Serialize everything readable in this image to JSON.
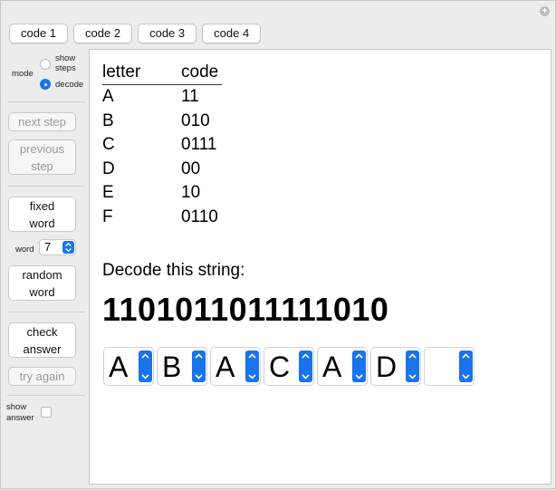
{
  "tabs": [
    "code 1",
    "code 2",
    "code 3",
    "code 4"
  ],
  "sidebar": {
    "mode_label": "mode",
    "options": [
      {
        "label_line1": "show",
        "label_line2": "steps",
        "selected": false
      },
      {
        "label_line1": "decode",
        "label_line2": "",
        "selected": true
      }
    ],
    "next_step": "next step",
    "previous_step_line1": "previous",
    "previous_step_line2": "step",
    "fixed_word_line1": "fixed",
    "fixed_word_line2": "word",
    "word_label": "word",
    "word_value": "7",
    "random_word_line1": "random",
    "random_word_line2": "word",
    "check_answer_line1": "check",
    "check_answer_line2": "answer",
    "try_again": "try again",
    "show_answer_line1": "show",
    "show_answer_line2": "answer",
    "show_answer_checked": false
  },
  "table": {
    "headers": [
      "letter",
      "code"
    ],
    "rows": [
      [
        "A",
        "11"
      ],
      [
        "B",
        "010"
      ],
      [
        "C",
        "0111"
      ],
      [
        "D",
        "00"
      ],
      [
        "E",
        "10"
      ],
      [
        "F",
        "0110"
      ]
    ]
  },
  "decode": {
    "title": "Decode this string:",
    "bits": "1101011011111010",
    "letters": [
      "A",
      "B",
      "A",
      "C",
      "A",
      "D",
      ""
    ]
  },
  "colors": {
    "accent": "#1a73e8"
  }
}
